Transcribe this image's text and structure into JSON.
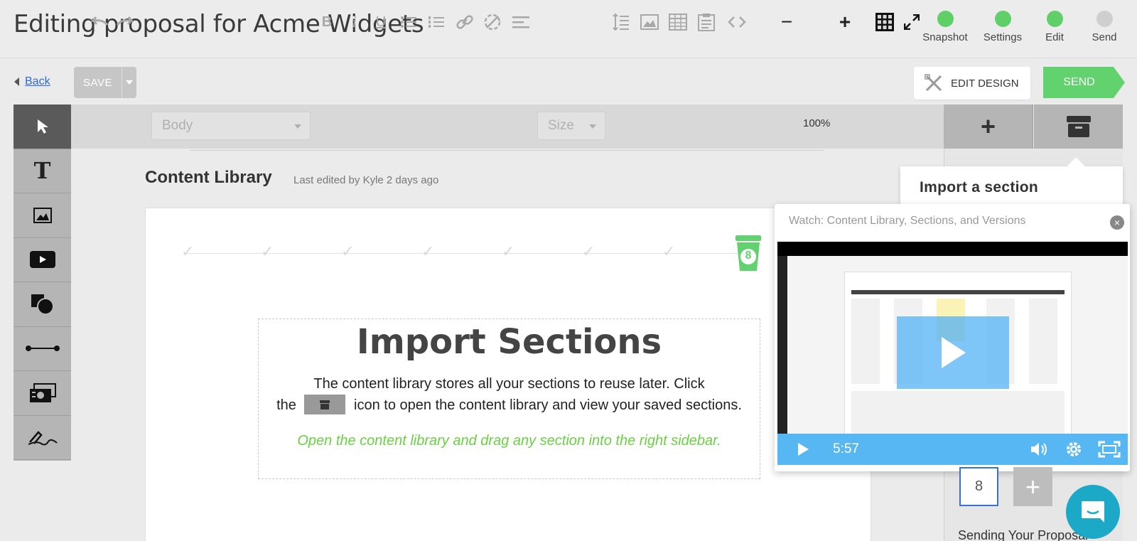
{
  "header": {
    "title": "Editing proposal for Acme Widgets",
    "steps": [
      {
        "label": "Snapshot",
        "status": "complete"
      },
      {
        "label": "Settings",
        "status": "complete"
      },
      {
        "label": "Edit",
        "status": "complete"
      },
      {
        "label": "Send",
        "status": "incomplete"
      }
    ]
  },
  "toolbar": {
    "back_label": "Back",
    "save_label": "SAVE",
    "edit_design_label": "EDIT DESIGN",
    "send_label": "SEND",
    "style_select": "Body",
    "size_select": "Size",
    "zoom": "100%"
  },
  "tools": [
    "pointer-icon",
    "text-icon",
    "image-icon",
    "video-icon",
    "shapes-icon",
    "line-icon",
    "pricing-icon",
    "signature-icon"
  ],
  "document": {
    "title": "Content Library",
    "last_edited": "Last edited by Kyle 2 days ago",
    "progress_badge": "8",
    "import_title": "Import Sections",
    "import_desc_1": "The content library stores all your sections to reuse later. Click",
    "import_desc_2a": "the",
    "import_desc_2b": "icon to open the content library and view your saved sections.",
    "import_hint": "Open the content library and drag any section into the right sidebar."
  },
  "import_popover": {
    "title": "Import a section"
  },
  "video": {
    "title": "Watch: Content Library, Sections, and Versions",
    "duration": "5:57"
  },
  "sidebar": {
    "thumb_number": "8",
    "caption": "Sending Your Proposal"
  },
  "colors": {
    "green": "#62d26f",
    "step_complete": "#5fd068",
    "step_incomplete": "#cfcfcf",
    "link": "#2b6bd6",
    "video_blue": "#57b7f3",
    "hint_green": "#6ad044",
    "chat": "#1ca8c7"
  }
}
